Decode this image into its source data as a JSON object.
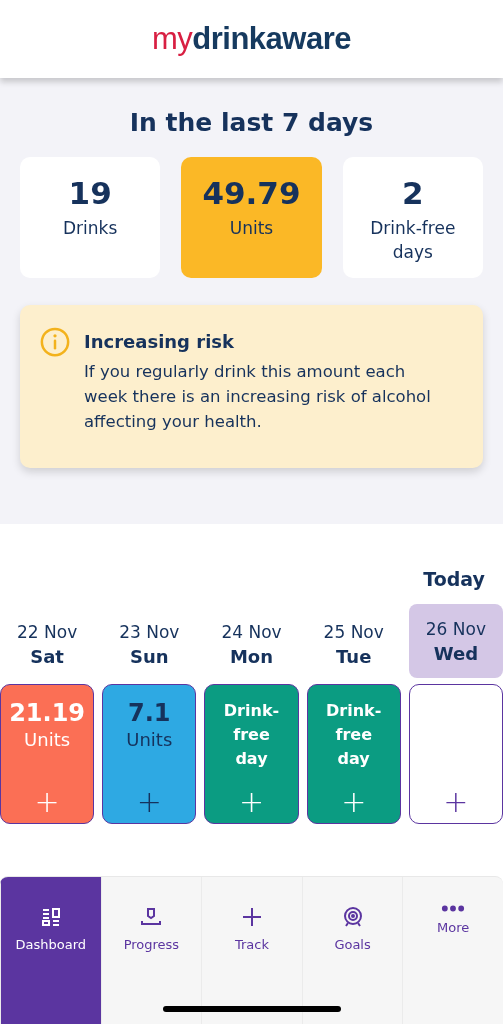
{
  "logo": {
    "prefix": "my",
    "name": "drinkaware"
  },
  "summary": {
    "title": "In the last 7 days",
    "stats": [
      {
        "value": "19",
        "label": "Drinks",
        "highlight": false
      },
      {
        "value": "49.79",
        "label": "Units",
        "highlight": true
      },
      {
        "value": "2",
        "label": "Drink-free days",
        "highlight": false
      }
    ]
  },
  "alert": {
    "title": "Increasing risk",
    "text": "If you regularly drink this amount each week there is an increasing risk of alcohol affecting your health."
  },
  "week": {
    "today_label": "Today",
    "days": [
      {
        "date": "22 Nov",
        "weekday": "Sat",
        "kind": "high",
        "value": "21.19",
        "unit": "Units",
        "color": "#fb6f55",
        "today": false,
        "add": "+"
      },
      {
        "date": "23 Nov",
        "weekday": "Sun",
        "kind": "low",
        "value": "7.1",
        "unit": "Units",
        "color": "#2ea9e3",
        "today": false,
        "add": "+"
      },
      {
        "date": "24 Nov",
        "weekday": "Mon",
        "kind": "drink_free",
        "text": "Drink-free day",
        "color": "#0b9c82",
        "today": false,
        "add": "+"
      },
      {
        "date": "25 Nov",
        "weekday": "Tue",
        "kind": "drink_free",
        "text": "Drink-free day",
        "color": "#0b9c82",
        "today": false,
        "add": "+"
      },
      {
        "date": "26 Nov",
        "weekday": "Wed",
        "kind": "empty",
        "color": "#ffffff",
        "today": true,
        "add": "+"
      }
    ]
  },
  "nav": [
    {
      "label": "Dashboard",
      "selected": true
    },
    {
      "label": "Progress",
      "selected": false
    },
    {
      "label": "Track",
      "selected": false
    },
    {
      "label": "Goals",
      "selected": false
    },
    {
      "label": "More",
      "selected": false
    }
  ]
}
